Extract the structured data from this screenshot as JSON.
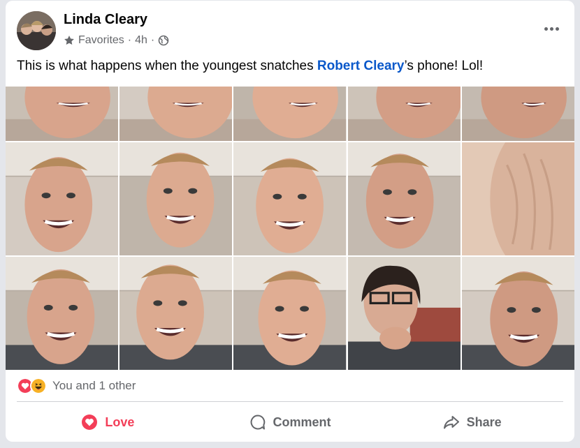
{
  "post": {
    "author": "Linda Cleary",
    "audience": "Favorites",
    "time": "4h",
    "separator": "·",
    "caption_before": "This is what happens when the youngest snatches ",
    "caption_link": "Robert Cleary",
    "caption_after": "’s phone! Lol!",
    "photo_count": 15
  },
  "reactions": {
    "summary": "You and 1 other",
    "icons": [
      "love-icon",
      "haha-icon"
    ]
  },
  "actions": {
    "love_label": "Love",
    "comment_label": "Comment",
    "share_label": "Share"
  },
  "colors": {
    "link": "#0a58ca",
    "love": "#f33e58",
    "muted": "#65676b"
  }
}
